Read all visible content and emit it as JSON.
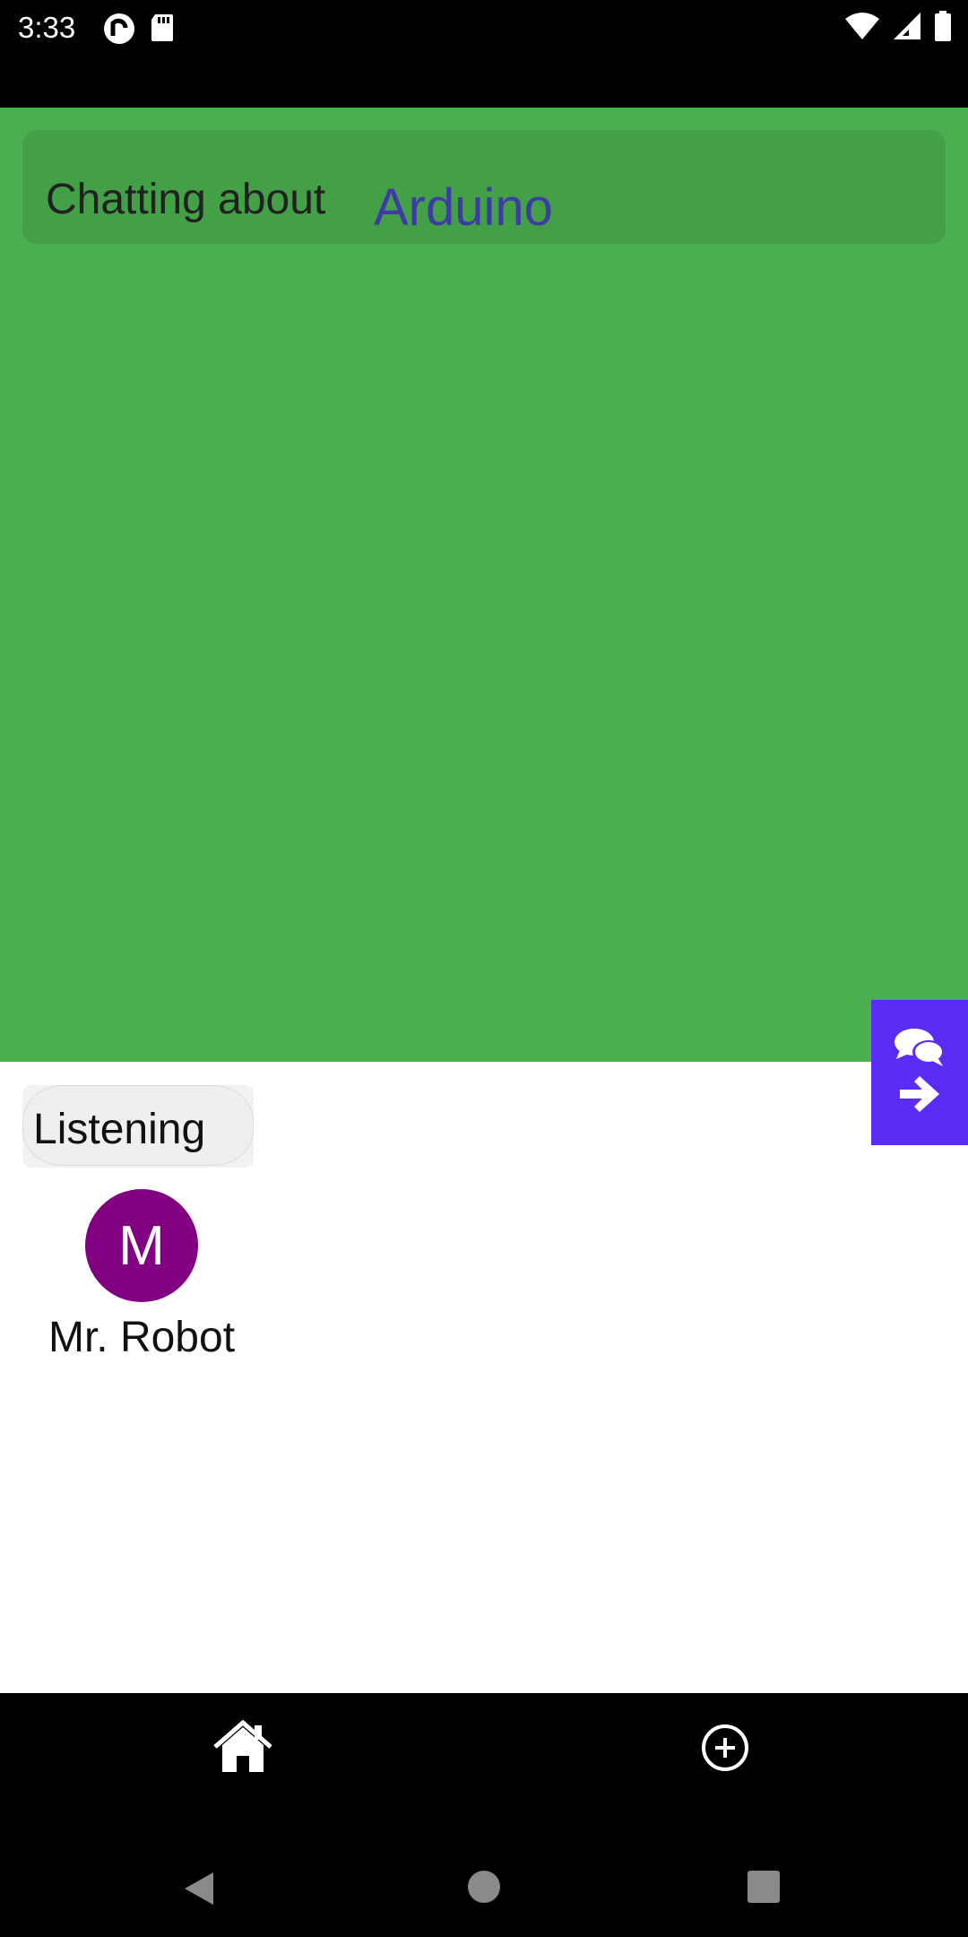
{
  "status_bar": {
    "time": "3:33",
    "left_icons": [
      "pocket-casts-icon",
      "sd-card-icon"
    ],
    "right_icons": [
      "wifi-icon",
      "cell-signal-icon",
      "battery-icon"
    ]
  },
  "header": {
    "prefix": "Chatting about",
    "topic": "Arduino"
  },
  "side_action": {
    "icons": [
      "chat-bubbles-icon",
      "arrow-right-icon"
    ]
  },
  "status_chip": {
    "label": "Listening"
  },
  "participant": {
    "initial": "M",
    "name": "Mr. Robot"
  },
  "bottom_nav": {
    "icons": [
      "home-icon",
      "add-circle-icon"
    ]
  },
  "colors": {
    "main_bg": "#4caf50",
    "header_bg": "#43a047",
    "topic_text": "#3f3aa6",
    "side_action_bg": "#5b2cf6",
    "avatar_bg": "#800080"
  }
}
